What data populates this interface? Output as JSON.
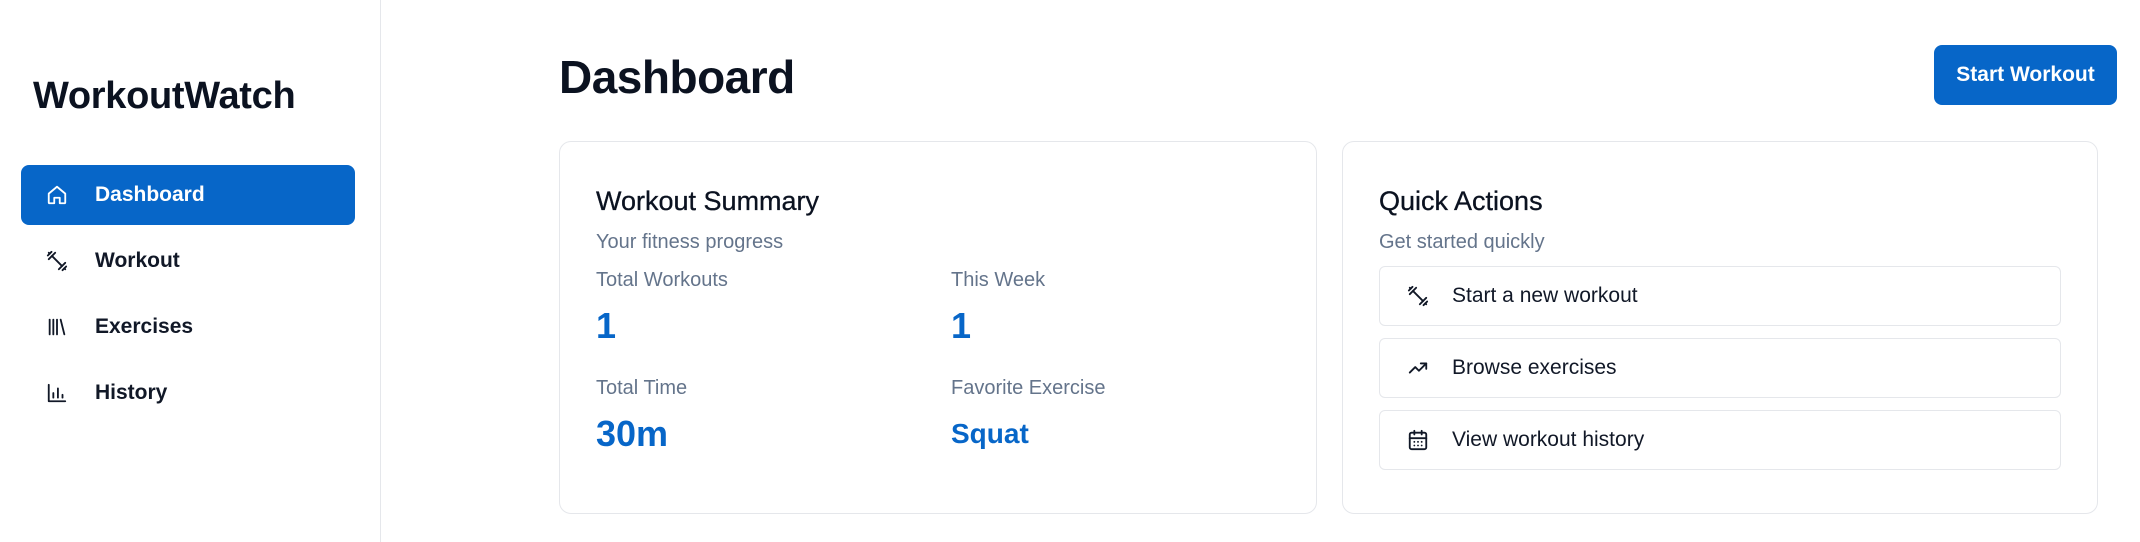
{
  "sidebar": {
    "brand": "WorkoutWatch",
    "items": [
      {
        "label": "Dashboard",
        "icon": "home-icon",
        "active": true
      },
      {
        "label": "Workout",
        "icon": "dumbbell-icon",
        "active": false
      },
      {
        "label": "Exercises",
        "icon": "library-icon",
        "active": false
      },
      {
        "label": "History",
        "icon": "bar-chart-icon",
        "active": false
      }
    ]
  },
  "header": {
    "title": "Dashboard",
    "start_workout_label": "Start Workout"
  },
  "summary": {
    "title": "Workout Summary",
    "subtitle": "Your fitness progress",
    "stats": [
      {
        "label": "Total Workouts",
        "value": "1"
      },
      {
        "label": "This Week",
        "value": "1"
      },
      {
        "label": "Total Time",
        "value": "30m"
      },
      {
        "label": "Favorite Exercise",
        "value": "Squat"
      }
    ]
  },
  "quick_actions": {
    "title": "Quick Actions",
    "subtitle": "Get started quickly",
    "items": [
      {
        "label": "Start a new workout",
        "icon": "dumbbell-icon"
      },
      {
        "label": "Browse exercises",
        "icon": "trending-up-icon"
      },
      {
        "label": "View workout history",
        "icon": "calendar-icon"
      }
    ]
  },
  "colors": {
    "accent": "#0766c8",
    "muted_text": "#64748b",
    "border": "#e5e7eb"
  }
}
